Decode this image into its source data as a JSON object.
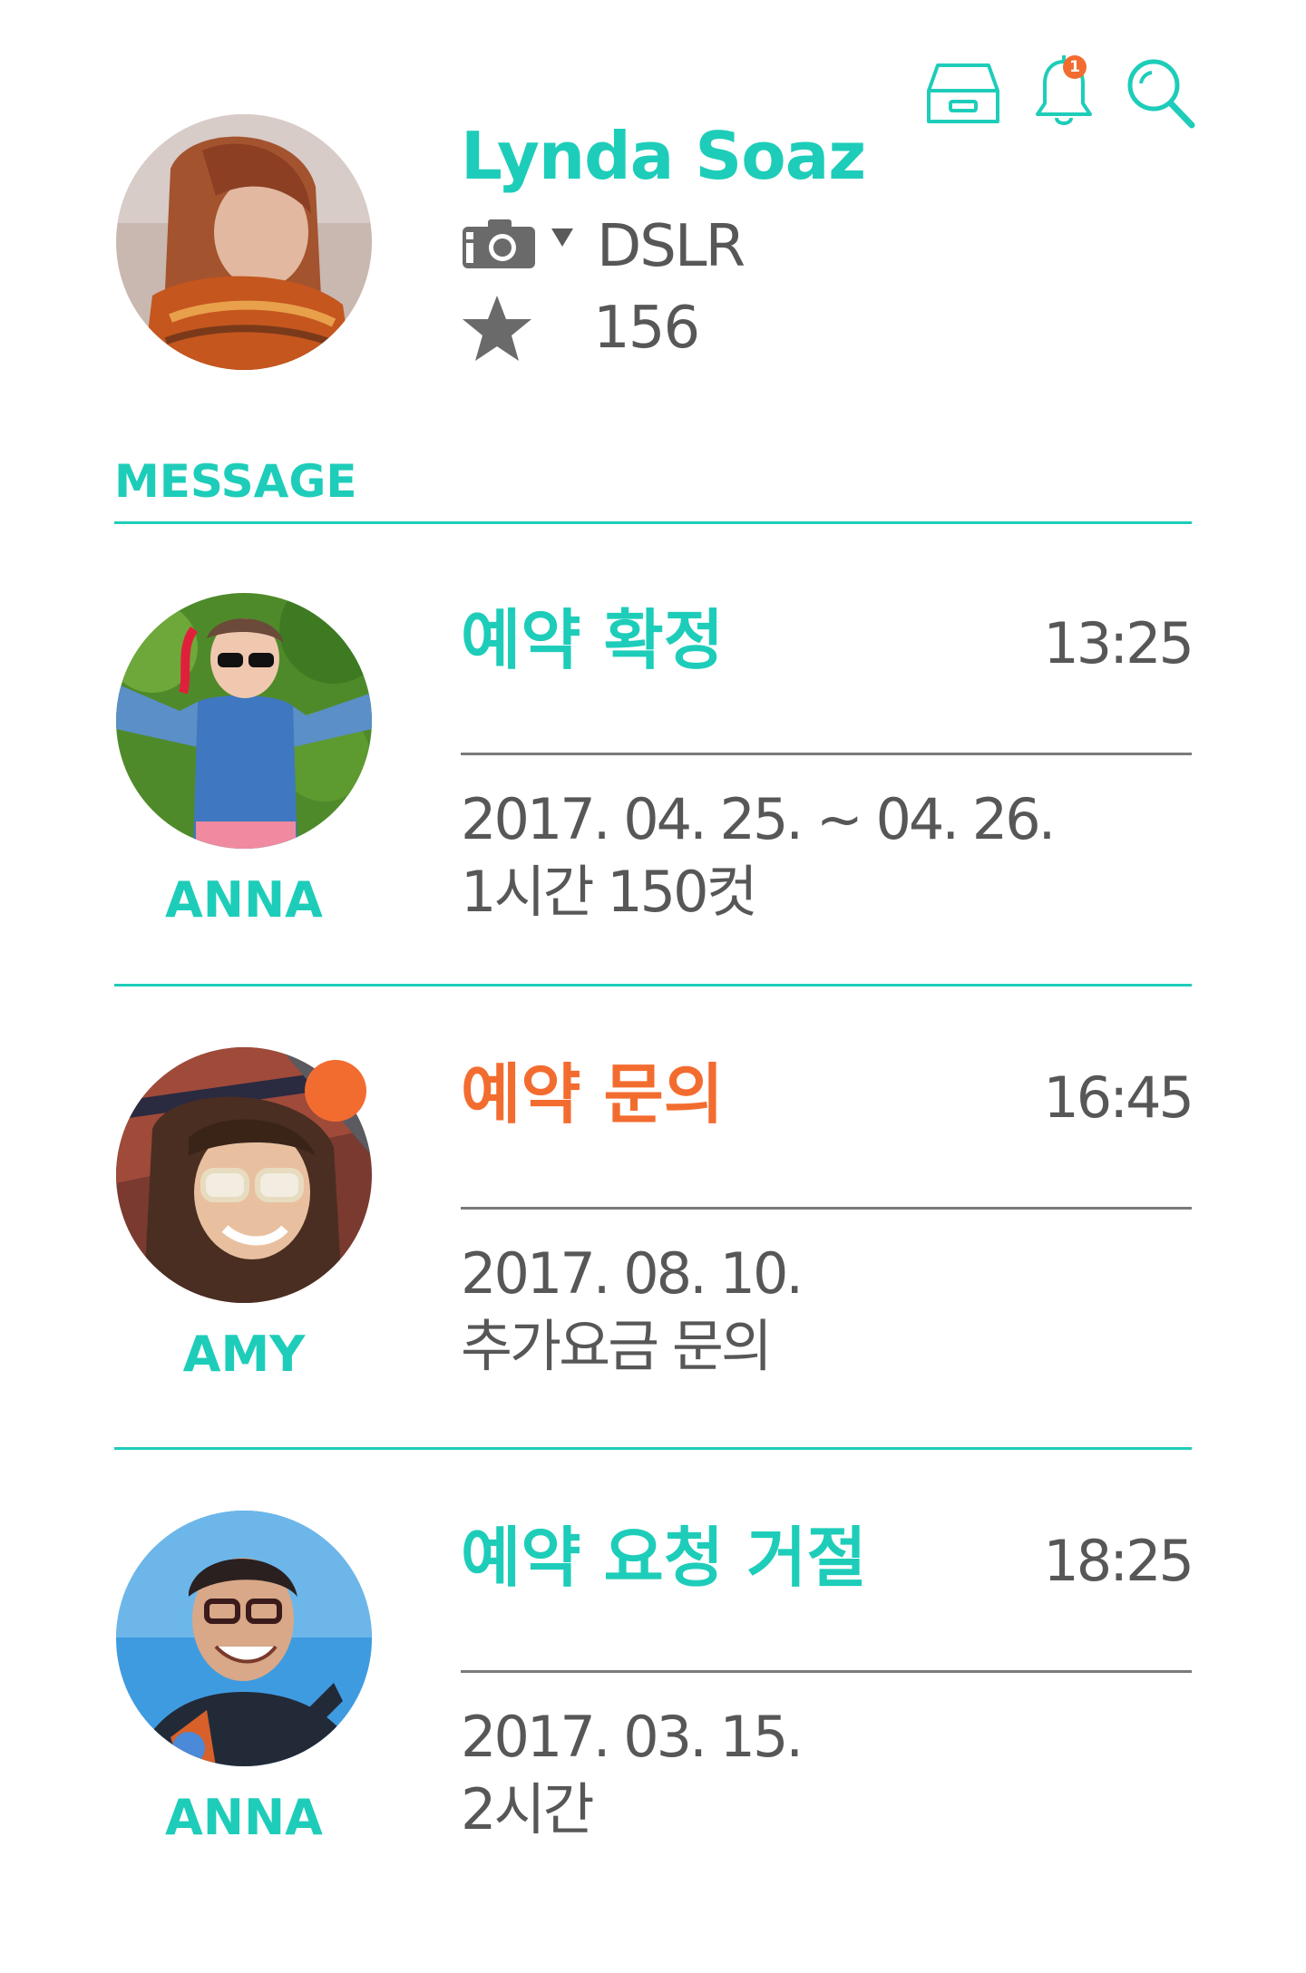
{
  "app": {
    "accent": "#1ecdb9",
    "alert": "#f36c2f",
    "text": "#575757"
  },
  "toolbar": {
    "icons": [
      "inbox-icon",
      "bell-icon",
      "search-icon"
    ],
    "notification_count": "1"
  },
  "profile": {
    "name": "Lynda Soaz",
    "camera_type": "DSLR",
    "rating": "156",
    "icons": [
      "camera-icon",
      "star-icon"
    ]
  },
  "messages_section": {
    "title": "MESSAGE",
    "items": [
      {
        "sender": "ANNA",
        "title": "예약 확정",
        "time": "13:25",
        "line1": "2017. 04. 25. ~ 04. 26.",
        "line2": "1시간 150컷",
        "unread": false,
        "title_color": "#1ecdb9"
      },
      {
        "sender": "AMY",
        "title": "예약 문의",
        "time": "16:45",
        "line1": "2017. 08. 10.",
        "line2": "추가요금 문의",
        "unread": true,
        "title_color": "#f36c2f"
      },
      {
        "sender": "ANNA",
        "title": "예약 요청 거절",
        "time": "18:25",
        "line1": "2017. 03. 15.",
        "line2": "2시간",
        "unread": false,
        "title_color": "#1ecdb9"
      }
    ]
  }
}
